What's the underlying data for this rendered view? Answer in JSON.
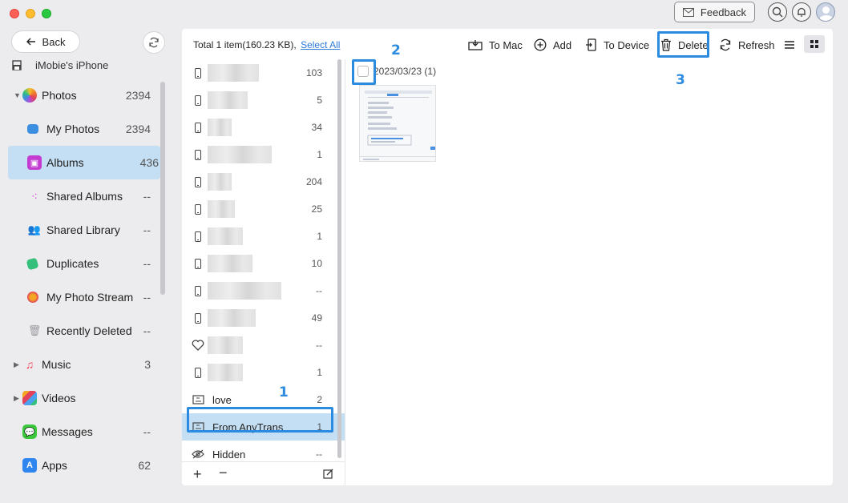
{
  "window": {
    "feedback_label": "Feedback"
  },
  "sidebar": {
    "back_label": "Back",
    "device_name": "iMobie's iPhone",
    "items": [
      {
        "label": "Photos",
        "count": "2394",
        "icon": "photos-icon",
        "color": "#f3a52c"
      },
      {
        "label": "My Photos",
        "count": "2394",
        "icon": "my-photos-icon",
        "color": "#3c8fe0"
      },
      {
        "label": "Albums",
        "count": "436",
        "icon": "albums-icon",
        "color": "#c43bd1"
      },
      {
        "label": "Shared Albums",
        "count": "--",
        "icon": "shared-albums-icon",
        "color": "#d54bd8"
      },
      {
        "label": "Shared Library",
        "count": "--",
        "icon": "shared-library-icon",
        "color": "#f07f2a"
      },
      {
        "label": "Duplicates",
        "count": "--",
        "icon": "duplicates-icon",
        "color": "#34c07a"
      },
      {
        "label": "My Photo Stream",
        "count": "--",
        "icon": "photo-stream-icon",
        "color": "#f5a623"
      },
      {
        "label": "Recently Deleted",
        "count": "--",
        "icon": "trash-icon",
        "color": "#9a9aa0"
      },
      {
        "label": "Music",
        "count": "3",
        "icon": "music-icon",
        "color": "#f1455a"
      },
      {
        "label": "Videos",
        "count": "",
        "icon": "videos-icon",
        "color": "#4aa3f0"
      },
      {
        "label": "Messages",
        "count": "--",
        "icon": "messages-icon",
        "color": "#3cc83c"
      },
      {
        "label": "Apps",
        "count": "62",
        "icon": "apps-icon",
        "color": "#2f86ef"
      }
    ]
  },
  "toolbar": {
    "total_text": "Total 1 item(160.23 KB),",
    "select_all": "Select All",
    "to_mac": "To Mac",
    "add": "Add",
    "to_device": "To Device",
    "delete": "Delete",
    "refresh": "Refresh"
  },
  "albums": [
    {
      "name": "",
      "count": "103",
      "icon": "phone"
    },
    {
      "name": "",
      "count": "5",
      "icon": "phone"
    },
    {
      "name": "",
      "count": "34",
      "icon": "phone"
    },
    {
      "name": "",
      "count": "1",
      "icon": "phone"
    },
    {
      "name": "",
      "count": "204",
      "icon": "phone"
    },
    {
      "name": "",
      "count": "25",
      "icon": "phone"
    },
    {
      "name": "",
      "count": "1",
      "icon": "phone"
    },
    {
      "name": "",
      "count": "10",
      "icon": "phone"
    },
    {
      "name": "",
      "count": "--",
      "icon": "phone"
    },
    {
      "name": "",
      "count": "49",
      "icon": "phone"
    },
    {
      "name": "",
      "count": "--",
      "icon": "heart"
    },
    {
      "name": "",
      "count": "1",
      "icon": "phone"
    },
    {
      "name": "love",
      "count": "2",
      "icon": "album"
    },
    {
      "name": "From AnyTrans",
      "count": "1",
      "icon": "album"
    },
    {
      "name": "Hidden",
      "count": "--",
      "icon": "hidden"
    }
  ],
  "content": {
    "date_group": "2023/03/23 (1)"
  },
  "annotations": {
    "step1": "1",
    "step2": "2",
    "step3": "3"
  },
  "colors": {
    "accent": "#2b8be0",
    "selection": "#c4dff3",
    "link": "#2b7bd9"
  }
}
